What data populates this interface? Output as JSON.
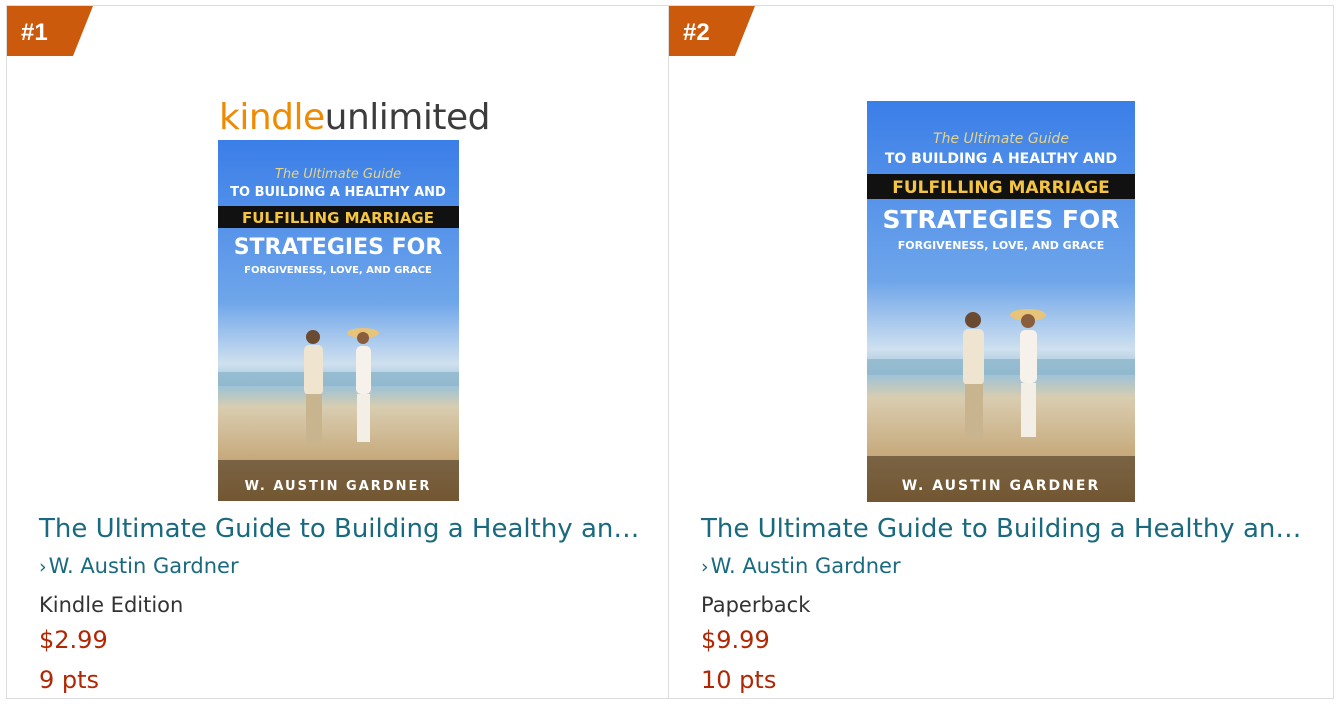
{
  "colors": {
    "badge": "#cc5a0c",
    "link": "#1a6a7f",
    "price": "#b12704",
    "border": "#dddddd"
  },
  "items": [
    {
      "rank": "#1",
      "logo": {
        "kindle": "kindle",
        "unlimited": "unlimited"
      },
      "cover": {
        "script": "The Ultimate Guide",
        "line1": "TO BUILDING A HEALTHY AND",
        "line2": "FULFILLING MARRIAGE",
        "line3": "STRATEGIES FOR",
        "line4": "FORGIVENESS, LOVE, AND GRACE",
        "author": "W. AUSTIN GARDNER"
      },
      "title": "The Ultimate Guide to Building a Healthy an…",
      "author_chevron": "›",
      "author": "W. Austin Gardner",
      "format": "Kindle Edition",
      "price": "$2.99",
      "points": "9 pts"
    },
    {
      "rank": "#2",
      "cover": {
        "script": "The Ultimate Guide",
        "line1": "TO BUILDING A HEALTHY AND",
        "line2": "FULFILLING MARRIAGE",
        "line3": "STRATEGIES FOR",
        "line4": "FORGIVENESS, LOVE, AND GRACE",
        "author": "W. AUSTIN GARDNER"
      },
      "title": "The Ultimate Guide to Building a Healthy an…",
      "author_chevron": "›",
      "author": "W. Austin Gardner",
      "format": "Paperback",
      "price": "$9.99",
      "points": "10 pts"
    }
  ]
}
